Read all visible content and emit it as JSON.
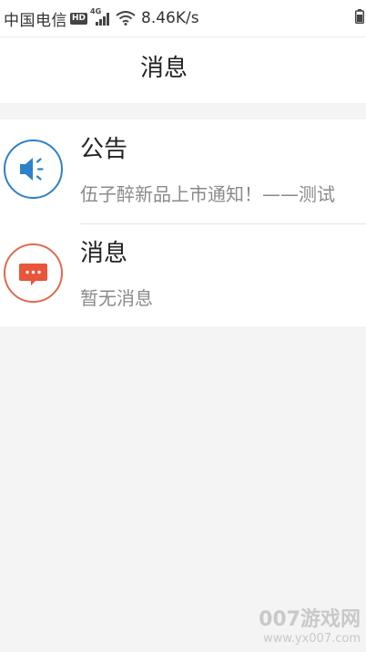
{
  "status_bar": {
    "carrier": "中国电信",
    "hd_badge": "HD",
    "network_type": "4G",
    "speed": "8.46K/s"
  },
  "header": {
    "title": "消息"
  },
  "messages": [
    {
      "title": "公告",
      "subtitle": "伍子醉新品上市通知！——测试",
      "icon": "megaphone-icon",
      "accent": "#2b82c9"
    },
    {
      "title": "消息",
      "subtitle": "暂无消息",
      "icon": "chat-bubble-icon",
      "accent": "#e06a4e"
    }
  ],
  "watermark": {
    "brand": "007游戏网",
    "url": "www.yx007.com"
  }
}
